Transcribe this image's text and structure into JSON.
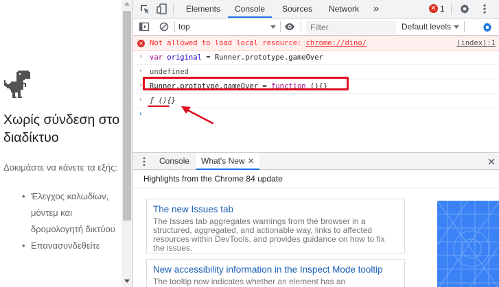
{
  "offline_page": {
    "title": "Χωρίς σύνδεση στο διαδίκτυο",
    "try_text": "Δοκιμάστε να κάνετε τα εξής:",
    "suggestions": [
      "Έλεγχος καλωδίων, μόντεμ και δρομολογητή δικτύου",
      "Επανασυνδεθείτε"
    ]
  },
  "devtools": {
    "tabs": [
      {
        "label": "Elements",
        "active": false
      },
      {
        "label": "Console",
        "active": true
      },
      {
        "label": "Sources",
        "active": false
      },
      {
        "label": "Network",
        "active": false
      }
    ],
    "more_tabs_glyph": "»",
    "error_count": "1",
    "console_toolbar": {
      "context": "top",
      "filter_placeholder": "Filter",
      "levels": "Default levels"
    },
    "messages": {
      "error_prefix": "Not allowed to load local resource: ",
      "error_url": "chrome://dino/",
      "error_source": "(index):1",
      "line1_kw": "var",
      "line1_var": "original",
      "line1_rest": " = Runner.prototype.gameOver",
      "line2": "undefined",
      "line3_pre": "Runner.prototype.gameOver = ",
      "line3_kw": "function",
      "line3_post": " (){}",
      "line4": "ƒ (){}"
    },
    "drawer": {
      "tabs": [
        {
          "label": "Console",
          "active": false
        },
        {
          "label": "What's New",
          "active": true
        }
      ],
      "close_glyph": "✕",
      "header": "Highlights from the Chrome 84 update",
      "cards": [
        {
          "title": "The new Issues tab",
          "desc": "The Issues tab aggregates warnings from the browser in a structured, aggregated, and actionable way, links to affected resources within DevTools, and provides guidance on how to fix the issues."
        },
        {
          "title": "New accessibility information in the Inspect Mode tooltip",
          "desc": "The tooltip now indicates whether an element has an"
        }
      ]
    }
  },
  "colors": {
    "accent": "#1a73e8",
    "error": "#fe2c2c",
    "annotation": "#e10d1f"
  }
}
